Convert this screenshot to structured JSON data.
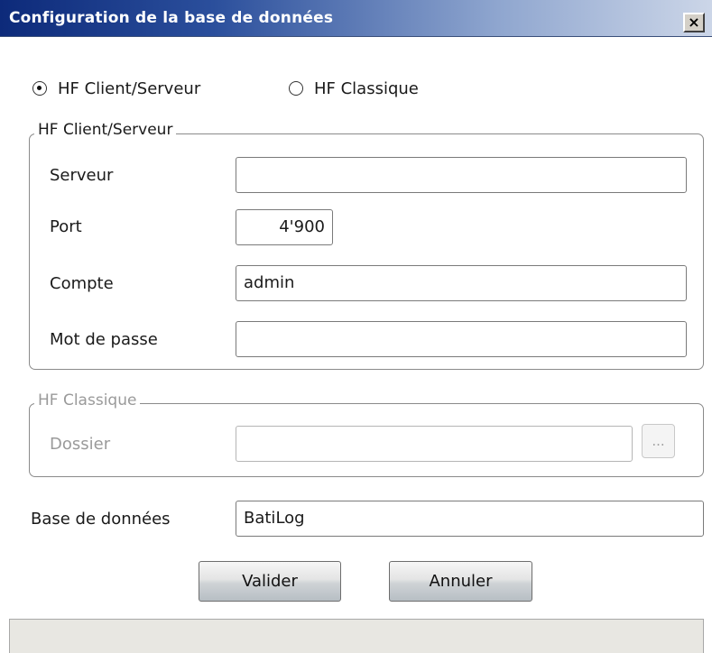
{
  "window": {
    "title": "Configuration de la base de données",
    "close_glyph": "×"
  },
  "mode": {
    "options": [
      {
        "label": "HF Client/Serveur",
        "selected": true
      },
      {
        "label": "HF Classique",
        "selected": false
      }
    ]
  },
  "client_server": {
    "legend": "HF Client/Serveur",
    "server_label": "Serveur",
    "server_value": "",
    "port_label": "Port",
    "port_value": "4'900",
    "account_label": "Compte",
    "account_value": "admin",
    "password_label": "Mot de passe",
    "password_value": ""
  },
  "classic": {
    "legend": "HF Classique",
    "folder_label": "Dossier",
    "folder_value": "",
    "browse_label": "...",
    "enabled": false
  },
  "database": {
    "label": "Base de données",
    "value": "BatiLog"
  },
  "buttons": {
    "validate": "Valider",
    "cancel": "Annuler"
  },
  "icons": {
    "close": "close-icon",
    "radio_selected": "radio-selected-icon",
    "radio_unselected": "radio-unselected-icon"
  }
}
